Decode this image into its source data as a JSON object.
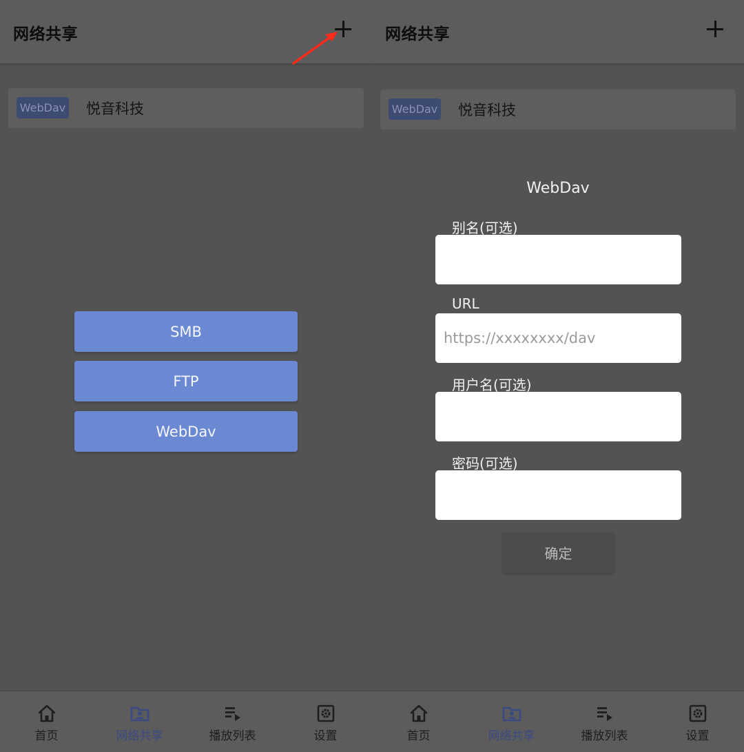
{
  "header": {
    "title": "网络共享"
  },
  "share_list": [
    {
      "type_badge": "WebDav",
      "name": "悦音科技"
    }
  ],
  "add_options": [
    {
      "label": "SMB"
    },
    {
      "label": "FTP"
    },
    {
      "label": "WebDav"
    }
  ],
  "webdav_form": {
    "title": "WebDav",
    "alias_label": "别名(可选)",
    "alias_value": "",
    "url_label": "URL",
    "url_placeholder": "https://xxxxxxxx/dav",
    "username_label": "用户名(可选)",
    "username_value": "",
    "password_label": "密码(可选)",
    "password_value": "",
    "confirm_label": "确定"
  },
  "bottom_nav": [
    {
      "label": "首页",
      "icon": "home-icon",
      "active": false
    },
    {
      "label": "网络共享",
      "icon": "folder-user-icon",
      "active": true
    },
    {
      "label": "播放列表",
      "icon": "playlist-icon",
      "active": false
    },
    {
      "label": "设置",
      "icon": "gear-icon",
      "active": false
    }
  ],
  "colors": {
    "background": "#535353",
    "button_blue": "#6b89d3",
    "badge_bg": "#3d4a72",
    "nav_active": "#3c4a82",
    "annotation_arrow": "#ff2a1a"
  }
}
